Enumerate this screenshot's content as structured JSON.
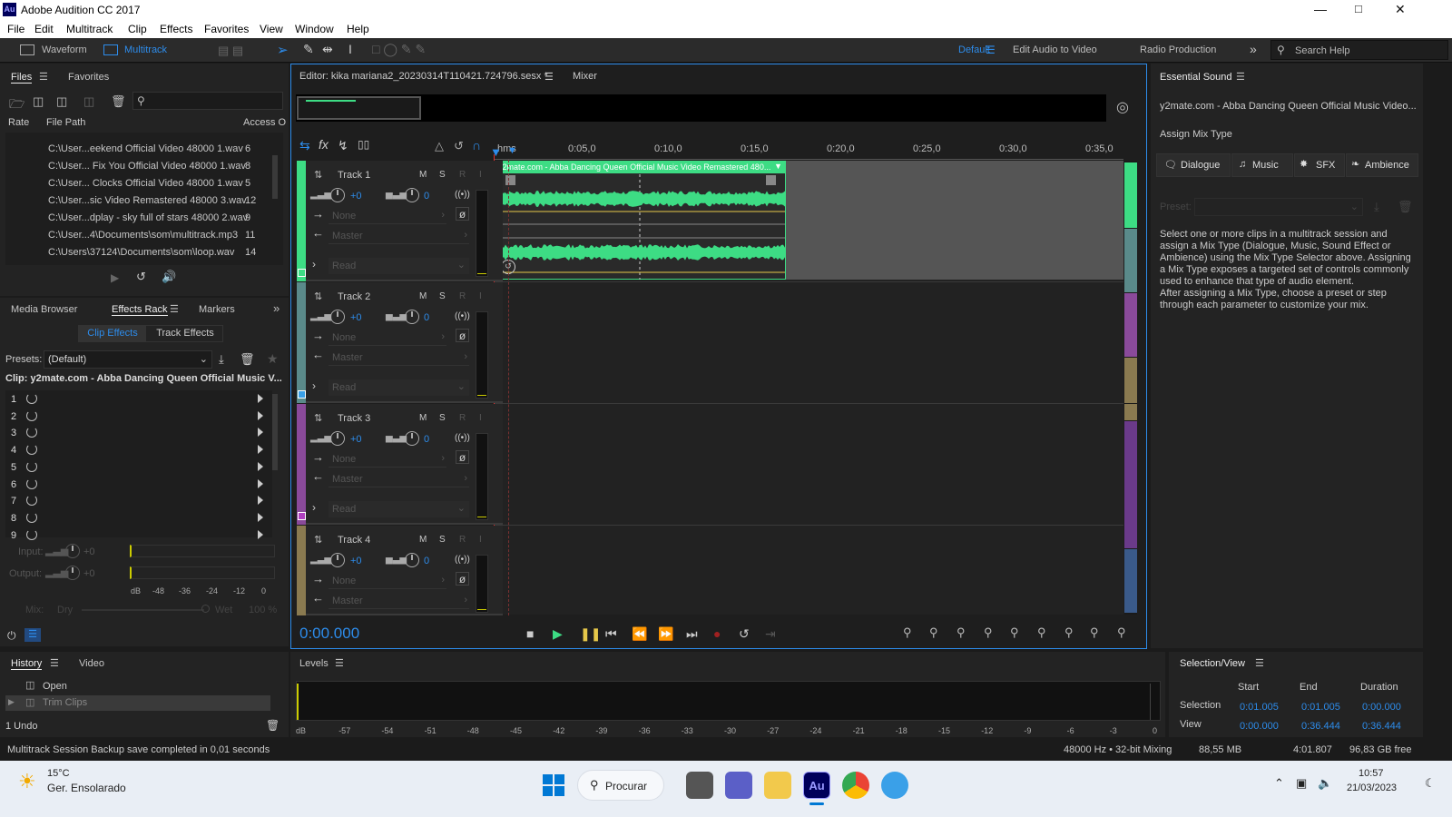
{
  "window": {
    "title": "Adobe Audition CC 2017",
    "logo": "Au"
  },
  "menu": [
    "File",
    "Edit",
    "Multitrack",
    "Clip",
    "Effects",
    "Favorites",
    "View",
    "Window",
    "Help"
  ],
  "toolbar": {
    "waveform": "Waveform",
    "multitrack": "Multitrack",
    "workspaces": [
      "Default",
      "Edit Audio to Video",
      "Radio Production"
    ],
    "search_placeholder": "Search Help"
  },
  "files_panel": {
    "tabs": [
      "Files",
      "Favorites"
    ],
    "columns": [
      "Rate",
      "File Path",
      "Access O"
    ],
    "rows": [
      {
        "path": "C:\\User...eekend Official Video 48000 1.wav",
        "access": "6"
      },
      {
        "path": "C:\\User... Fix You Official Video 48000 1.wav",
        "access": "8"
      },
      {
        "path": "C:\\User... Clocks Official Video 48000 1.wav",
        "access": "5"
      },
      {
        "path": "C:\\User...sic Video Remastered 48000 3.wav",
        "access": "12"
      },
      {
        "path": "C:\\User...dplay - sky full of stars 48000 2.wav",
        "access": "9"
      },
      {
        "path": "C:\\User...4\\Documents\\som\\multitrack.mp3",
        "access": "11"
      },
      {
        "path": "C:\\Users\\37124\\Documents\\som\\loop.wav",
        "access": "14"
      }
    ]
  },
  "effects_panel": {
    "tabs": [
      "Media Browser",
      "Effects Rack",
      "Markers"
    ],
    "subtabs": [
      "Clip Effects",
      "Track Effects"
    ],
    "presets_label": "Presets:",
    "preset_value": "(Default)",
    "clip_label": "Clip: y2mate.com - Abba  Dancing Queen Official Music V...",
    "slots": [
      "1",
      "2",
      "3",
      "4",
      "5",
      "6",
      "7",
      "8",
      "9"
    ],
    "input_label": "Input:",
    "output_label": "Output:",
    "input_value": "+0",
    "output_value": "+0",
    "meter_ticks": [
      "dB",
      "-48",
      "-36",
      "-24",
      "-12",
      "0"
    ],
    "mix_label": "Mix:",
    "dry": "Dry",
    "wet": "Wet",
    "wet_value": "100 %"
  },
  "history_panel": {
    "tabs": [
      "History",
      "Video"
    ],
    "items": [
      "Open",
      "Trim Clips"
    ],
    "undo": "1 Undo"
  },
  "editor": {
    "tab_title": "Editor: kika mariana2_20230314T110421.724796.sesx *",
    "mixer_tab": "Mixer",
    "ruler": [
      "hms",
      "0:05,0",
      "0:10,0",
      "0:15,0",
      "0:20,0",
      "0:25,0",
      "0:30,0",
      "0:35,0"
    ],
    "tracks": [
      {
        "name": "Track 1",
        "volume": "+0",
        "pan": "0",
        "input": "None",
        "output": "Master",
        "automation": "Read",
        "color": "#3ddc84"
      },
      {
        "name": "Track 2",
        "volume": "+0",
        "pan": "0",
        "input": "None",
        "output": "Master",
        "automation": "Read",
        "color": "#5a8a8a"
      },
      {
        "name": "Track 3",
        "volume": "+0",
        "pan": "0",
        "input": "None",
        "output": "Master",
        "automation": "Read",
        "color": "#8a4a9a"
      },
      {
        "name": "Track 4",
        "volume": "+0",
        "pan": "0",
        "input": "None",
        "output": "Master",
        "automation": "",
        "color": "#8a7a50"
      }
    ],
    "clip_title": "y2mate.com - Abba  Dancing Queen Official Music Video Remastered 480...",
    "time": "0:00.000"
  },
  "essential_sound": {
    "title": "Essential Sound",
    "clip_name": "y2mate.com - Abba  Dancing Queen Official Music Video...",
    "assign": "Assign Mix Type",
    "types": [
      "Dialogue",
      "Music",
      "SFX",
      "Ambience"
    ],
    "preset_label": "Preset:",
    "desc1": "Select one or more clips in a multitrack session and assign a Mix Type (Dialogue, Music, Sound Effect or Ambience) using the Mix Type Selector above. Assigning a Mix Type exposes a targeted set of controls commonly used to enhance that type of audio element.",
    "desc2": "After assigning a Mix Type, choose a preset or step through each parameter to customize your mix."
  },
  "levels": {
    "title": "Levels",
    "ticks": [
      "dB",
      "-57",
      "-54",
      "-51",
      "-48",
      "-45",
      "-42",
      "-39",
      "-36",
      "-33",
      "-30",
      "-27",
      "-24",
      "-21",
      "-18",
      "-15",
      "-12",
      "-9",
      "-6",
      "-3",
      "0"
    ]
  },
  "selection_view": {
    "title": "Selection/View",
    "headers": [
      "Start",
      "End",
      "Duration"
    ],
    "selection_label": "Selection",
    "view_label": "View",
    "selection": [
      "0:01.005",
      "0:01.005",
      "0:00.000"
    ],
    "view": [
      "0:00.000",
      "0:36.444",
      "0:36.444"
    ]
  },
  "status": {
    "message": "Multitrack Session Backup save completed in 0,01 seconds",
    "format": "48000 Hz • 32-bit Mixing",
    "memory": "88,55 MB",
    "duration": "4:01.807",
    "disk": "96,83 GB free"
  },
  "taskbar": {
    "temp": "15°C",
    "weather": "Ger. Ensolarado",
    "search": "Procurar",
    "time": "10:57",
    "date": "21/03/2023"
  },
  "colors": {
    "accent": "#2d8ceb",
    "wave": "#3ddc84",
    "playhead": "#e03030"
  }
}
